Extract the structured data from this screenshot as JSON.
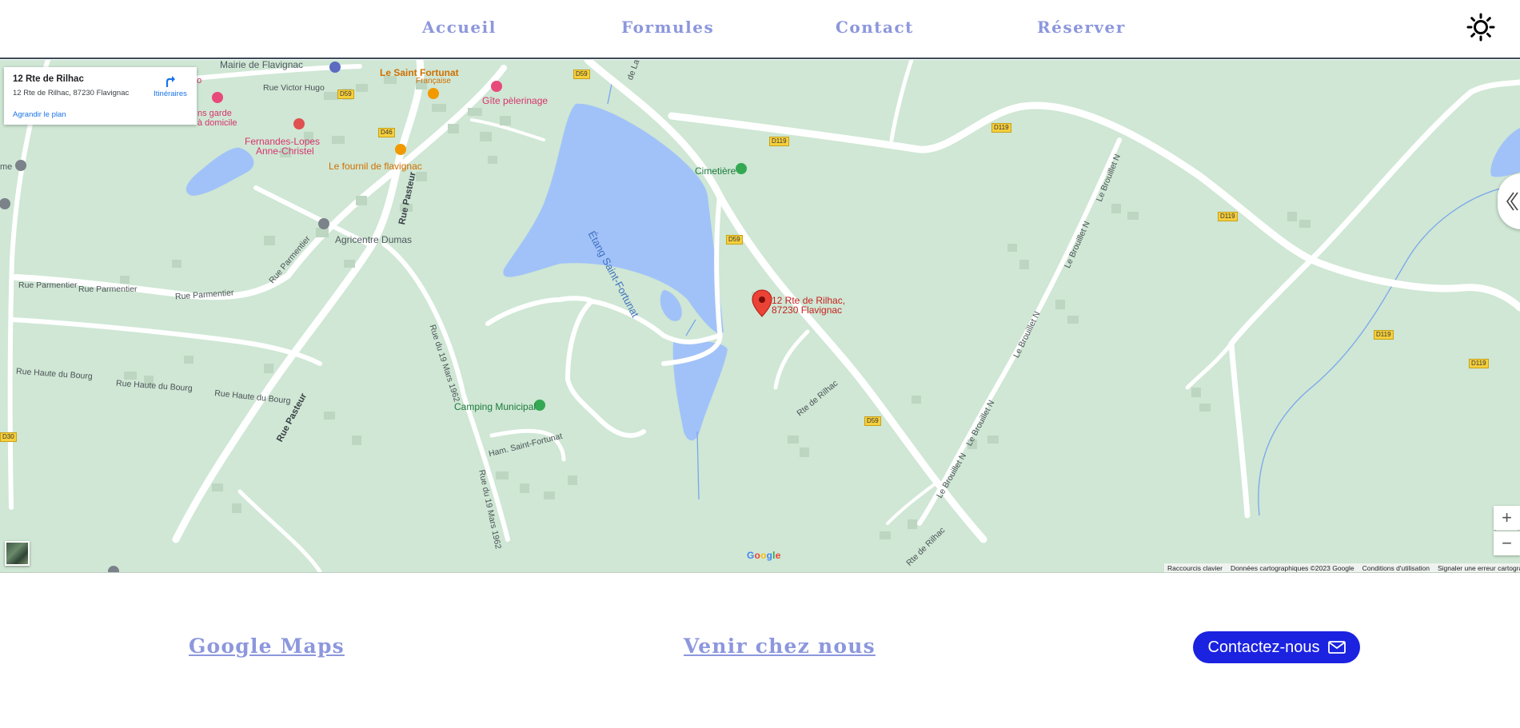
{
  "nav": {
    "items": [
      {
        "label": "Accueil"
      },
      {
        "label": "Formules"
      },
      {
        "label": "Contact"
      },
      {
        "label": "Réserver"
      }
    ],
    "theme_icon": "sun-icon"
  },
  "map": {
    "card": {
      "title": "12 Rte de Rilhac",
      "address": "12 Rte de Rilhac, 87230 Flavignac",
      "directions": "Itinéraires",
      "larger_map": "Agrandir le plan"
    },
    "marker": {
      "line1": "12 Rte de Rilhac,",
      "line2": "87230 Flavignac",
      "color": "#ea4335"
    },
    "pois": {
      "mairie": "Mairie de Flavignac",
      "saint_fortunat": "Le Saint Fortunat",
      "saint_fortunat_sub": "Française",
      "gite": "Gîte pèlerinage",
      "fernandes1": "Fernandes-Lopes",
      "fernandes2": "Anne-Christel",
      "garde1": "ns garde",
      "garde2": "à domicile",
      "go": "go",
      "me": "me",
      "fournil": "Le fournil de flavignac",
      "cimetiere": "Cimetière",
      "agricentre": "Agricentre Dumas",
      "camping": "Camping Municipal"
    },
    "lake": "Étang Saint-Fortunat",
    "streets": {
      "victor_hugo": "Rue Victor Hugo",
      "pasteur1": "Rue Pasteur",
      "pasteur2": "Rue Pasteur",
      "parmentier1": "Rue Parmentier",
      "parmentier2": "Rue Parmentier",
      "parmentier3": "Rue Parmentier",
      "parmentier4": "Rue Parmentier",
      "haute_bourg1": "Rue Haute du Bourg",
      "haute_bourg2": "Rue Haute du Bourg",
      "haute_bourg3": "Rue Haute du Bourg",
      "mars1": "Rue du 19 Mars 1962",
      "mars2": "Rue du 19 Mars 1962",
      "hameau": "Ham. Saint-Fortunat",
      "rilhac1": "Rte de Rilhac",
      "rilhac2": "Rte de Rilhac",
      "brouillet1": "Le Brouillet N",
      "brouillet2": "Le Brouillet N",
      "brouillet3": "Le Brouillet N",
      "brouillet4": "Le Brouillet N",
      "brouillet5": "Le Brouillet N",
      "de_la": "de La"
    },
    "shields": {
      "d59a": "D59",
      "d59b": "D59",
      "d59c": "D59",
      "d59d": "D59",
      "d46": "D46",
      "d119a": "D119",
      "d119b": "D119",
      "d119c": "D119",
      "d119d": "D119",
      "d119e": "D119",
      "d30": "D30"
    },
    "zoom_in": "+",
    "zoom_out": "−",
    "attribution": {
      "shortcuts": "Raccourcis clavier",
      "data": "Données cartographiques ©2023 Google",
      "terms": "Conditions d'utilisation",
      "report": "Signaler une erreur cartographique"
    },
    "logo": {
      "g1": "G",
      "o1": "o",
      "o2": "o",
      "g2": "g",
      "l": "l",
      "e": "e"
    },
    "colors": {
      "land": "#cfe7d4",
      "water": "#a1c2f8",
      "road": "#ffffff",
      "link": "#1a73e8"
    }
  },
  "footer": {
    "maps_link": "Google Maps",
    "visit_link": "Venir chez nous",
    "contact_button": "Contactez-nous",
    "contact_icon": "mail-icon",
    "accent": "#1b22e0",
    "link_color": "#8c97dd"
  }
}
